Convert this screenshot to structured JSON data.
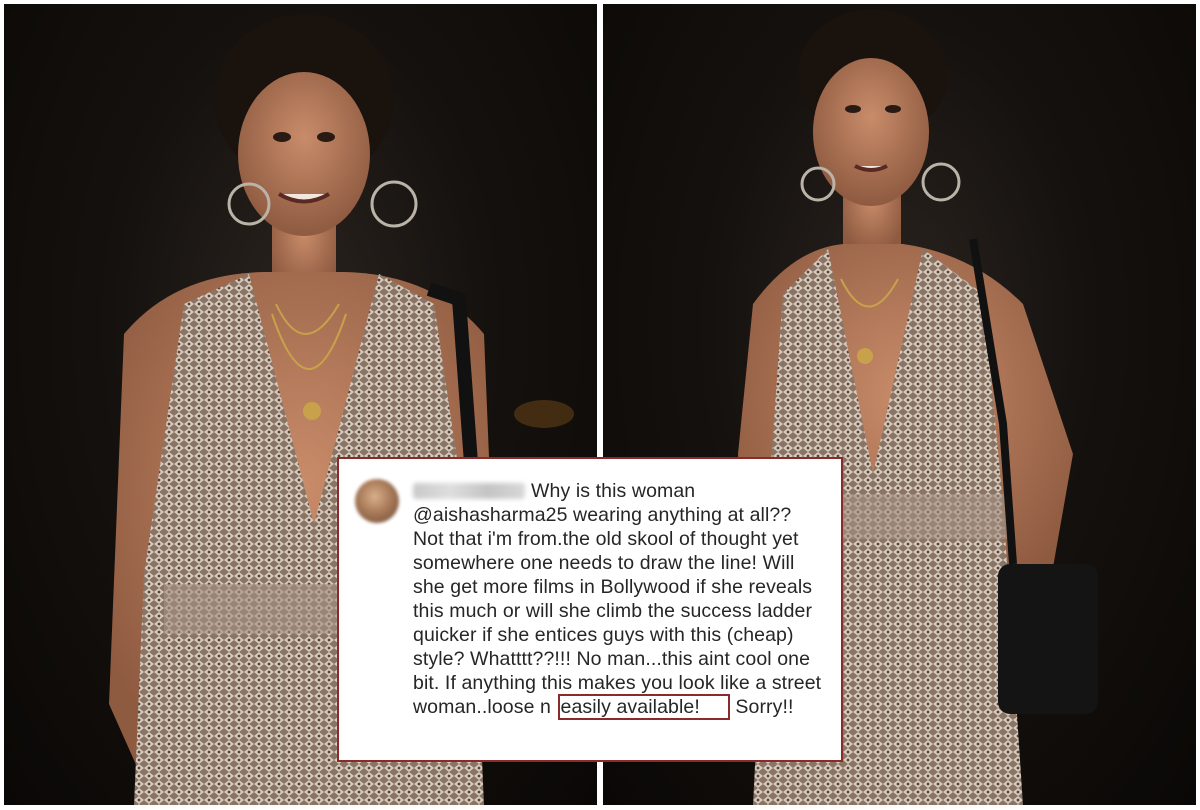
{
  "comment": {
    "username": "",
    "text_before_highlight": "Why is this woman @aishasharma25 wearing anything at all?? Not that i'm from.the old skool of thought yet somewhere one needs to draw the line! Will she get more films in Bollywood if she reveals this much or will she climb the success ladder quicker if she entices guys with this (cheap) style? Whatttt??!!! No man...this aint cool one bit. If anything this makes you look like a street woman..loose n ",
    "highlighted_text": "easily available!",
    "text_after_highlight": " Sorry!!"
  },
  "icons": {
    "avatar": "user-avatar-blurred",
    "carousel": "chevron-left-icon"
  },
  "colors": {
    "frame": "#8b2a2a",
    "photo_background": "#0a0806",
    "text": "#262626"
  }
}
